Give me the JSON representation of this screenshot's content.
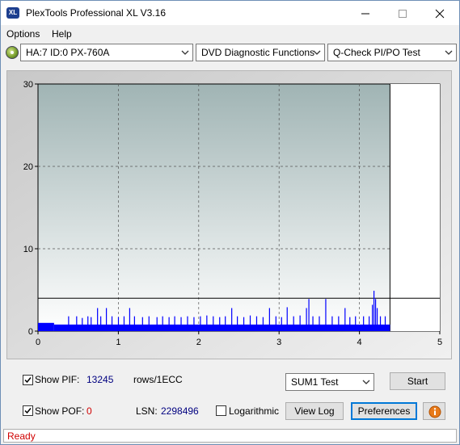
{
  "window": {
    "app_icon": "XL",
    "title": "PlexTools Professional XL V3.16",
    "controls": [
      "minimize-icon",
      "maximize-icon",
      "close-icon"
    ]
  },
  "menu": {
    "items": [
      "Options",
      "Help"
    ]
  },
  "toolbar": {
    "drive": "HA:7 ID:0  PX-760A",
    "function": "DVD Diagnostic Functions",
    "test": "Q-Check PI/PO Test",
    "drive_icon": "disc-drive-icon"
  },
  "chart_data": {
    "type": "bar",
    "background": "#a0b4b4",
    "bar_color": "#0000ff",
    "xlim": [
      0,
      5
    ],
    "ylim": [
      0,
      30
    ],
    "x_ticks": [
      "0",
      "1",
      "2",
      "3",
      "4",
      "5"
    ],
    "y_ticks": [
      "0",
      "10",
      "20",
      "30"
    ],
    "grid": true,
    "end_marker_x": 4.38,
    "threshold_line_y": 4,
    "baseline": {
      "x_range": [
        0,
        4.38
      ],
      "values": [
        [
          0,
          0.2,
          1.0
        ],
        [
          0.2,
          4.38,
          0.8
        ]
      ]
    },
    "spikes": [
      {
        "x": 0.38,
        "y": 1.8
      },
      {
        "x": 0.48,
        "y": 1.8
      },
      {
        "x": 0.55,
        "y": 1.6
      },
      {
        "x": 0.62,
        "y": 1.8
      },
      {
        "x": 0.66,
        "y": 1.7
      },
      {
        "x": 0.74,
        "y": 2.8
      },
      {
        "x": 0.78,
        "y": 1.8
      },
      {
        "x": 0.85,
        "y": 2.8
      },
      {
        "x": 0.92,
        "y": 1.8
      },
      {
        "x": 1.0,
        "y": 1.7
      },
      {
        "x": 1.07,
        "y": 1.8
      },
      {
        "x": 1.14,
        "y": 2.8
      },
      {
        "x": 1.2,
        "y": 1.8
      },
      {
        "x": 1.3,
        "y": 1.7
      },
      {
        "x": 1.38,
        "y": 1.8
      },
      {
        "x": 1.48,
        "y": 1.7
      },
      {
        "x": 1.55,
        "y": 1.8
      },
      {
        "x": 1.63,
        "y": 1.7
      },
      {
        "x": 1.7,
        "y": 1.8
      },
      {
        "x": 1.78,
        "y": 1.7
      },
      {
        "x": 1.86,
        "y": 1.8
      },
      {
        "x": 1.94,
        "y": 1.7
      },
      {
        "x": 2.02,
        "y": 1.8
      },
      {
        "x": 2.1,
        "y": 1.9
      },
      {
        "x": 2.18,
        "y": 1.8
      },
      {
        "x": 2.26,
        "y": 1.7
      },
      {
        "x": 2.33,
        "y": 1.8
      },
      {
        "x": 2.41,
        "y": 2.8
      },
      {
        "x": 2.48,
        "y": 1.8
      },
      {
        "x": 2.56,
        "y": 1.7
      },
      {
        "x": 2.64,
        "y": 1.9
      },
      {
        "x": 2.72,
        "y": 1.8
      },
      {
        "x": 2.8,
        "y": 1.7
      },
      {
        "x": 2.88,
        "y": 2.8
      },
      {
        "x": 2.96,
        "y": 1.8
      },
      {
        "x": 3.03,
        "y": 1.7
      },
      {
        "x": 3.1,
        "y": 2.9
      },
      {
        "x": 3.18,
        "y": 1.8
      },
      {
        "x": 3.26,
        "y": 1.9
      },
      {
        "x": 3.34,
        "y": 2.8
      },
      {
        "x": 3.37,
        "y": 3.9
      },
      {
        "x": 3.42,
        "y": 1.8
      },
      {
        "x": 3.5,
        "y": 1.8
      },
      {
        "x": 3.58,
        "y": 3.9
      },
      {
        "x": 3.66,
        "y": 1.8
      },
      {
        "x": 3.74,
        "y": 1.8
      },
      {
        "x": 3.82,
        "y": 2.8
      },
      {
        "x": 3.88,
        "y": 1.7
      },
      {
        "x": 3.95,
        "y": 1.8
      },
      {
        "x": 4.05,
        "y": 1.8
      },
      {
        "x": 4.12,
        "y": 1.8
      },
      {
        "x": 4.16,
        "y": 3.2
      },
      {
        "x": 4.18,
        "y": 4.9
      },
      {
        "x": 4.2,
        "y": 3.9
      },
      {
        "x": 4.22,
        "y": 2.8
      },
      {
        "x": 4.26,
        "y": 1.8
      },
      {
        "x": 4.32,
        "y": 1.8
      }
    ]
  },
  "bottom": {
    "show_pif_label": "Show PIF:",
    "pif_value": "13245",
    "rows_unit": "rows/1ECC",
    "show_pof_label": "Show POF:",
    "pof_value": "0",
    "lsn_label": "LSN:",
    "lsn_value": "2298496",
    "logarithmic_label": "Logarithmic",
    "sum_test": "SUM1 Test",
    "start_label": "Start",
    "viewlog_label": "View Log",
    "preferences_label": "Preferences",
    "info_icon": "info-icon",
    "pif_checked": true,
    "pof_checked": true,
    "log_checked": false,
    "pif_color": "#000080",
    "pof_color": "#d00000"
  },
  "status": {
    "text": "Ready",
    "color": "#d00000"
  }
}
